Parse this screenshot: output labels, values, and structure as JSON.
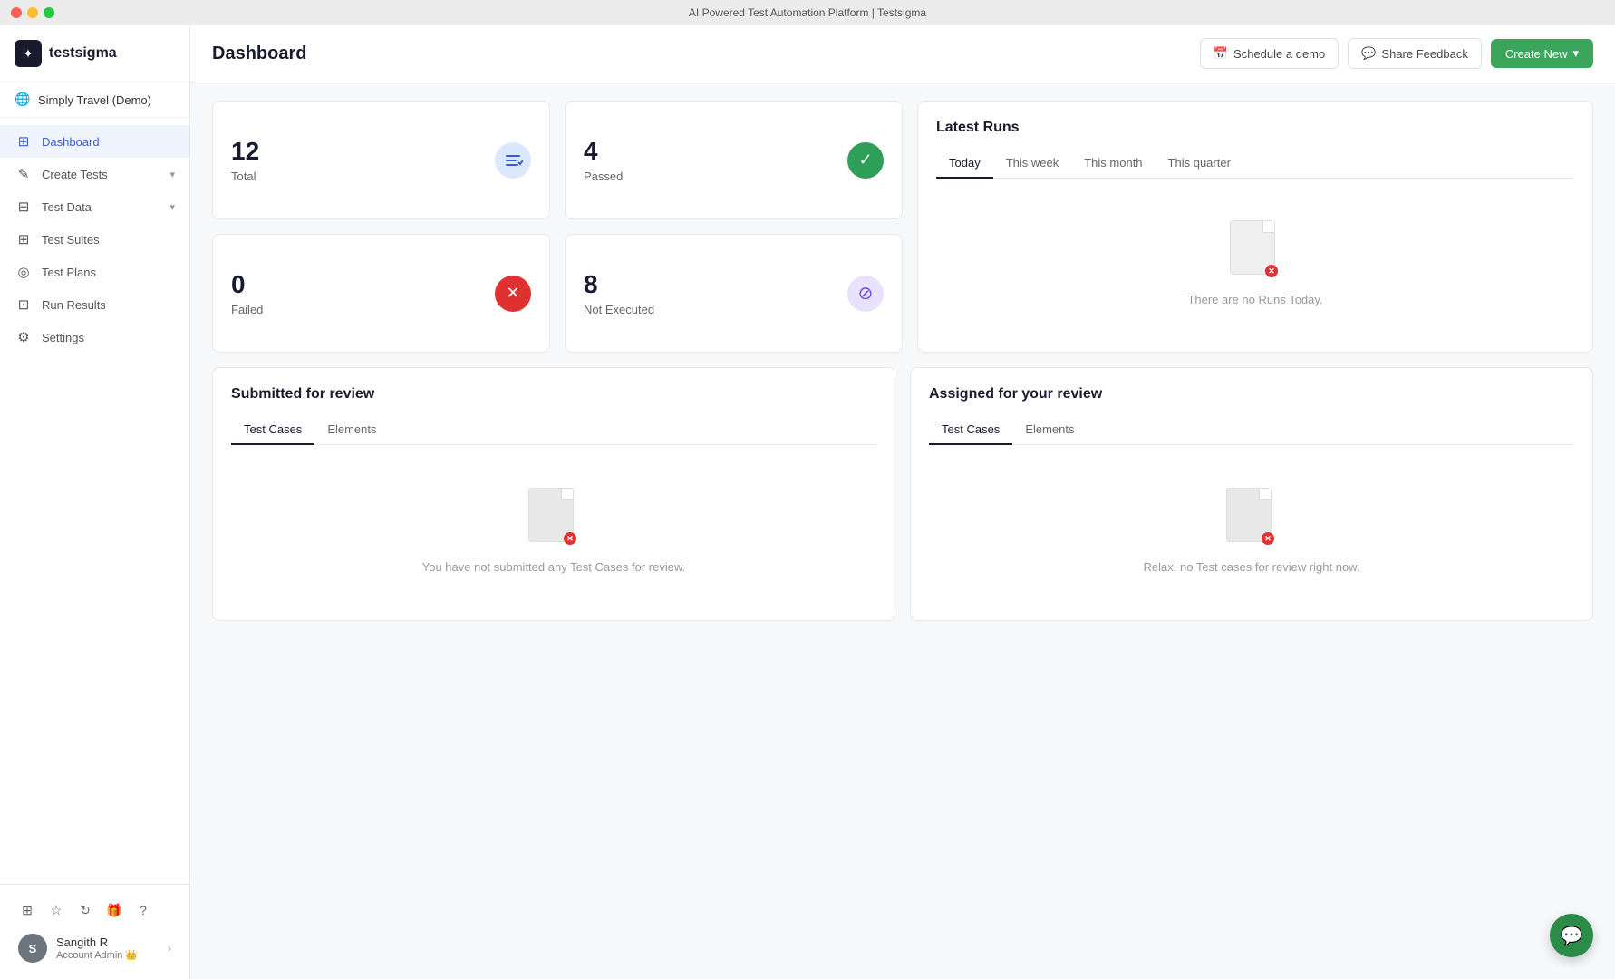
{
  "window": {
    "title": "AI Powered Test Automation Platform | Testsigma"
  },
  "sidebar": {
    "logo_text": "testsigma",
    "project_name": "Simply Travel (Demo)",
    "nav_items": [
      {
        "id": "dashboard",
        "label": "Dashboard",
        "icon": "⊞",
        "active": true
      },
      {
        "id": "create-tests",
        "label": "Create Tests",
        "icon": "✏️",
        "has_arrow": true
      },
      {
        "id": "test-data",
        "label": "Test Data",
        "icon": "⊟",
        "has_arrow": true
      },
      {
        "id": "test-suites",
        "label": "Test Suites",
        "icon": "⊞",
        "has_arrow": false
      },
      {
        "id": "test-plans",
        "label": "Test Plans",
        "icon": "◎",
        "has_arrow": false
      },
      {
        "id": "run-results",
        "label": "Run Results",
        "icon": "⊡",
        "has_arrow": false
      },
      {
        "id": "settings",
        "label": "Settings",
        "icon": "⚙",
        "has_arrow": false
      }
    ],
    "user": {
      "initials": "S",
      "name": "Sangith R",
      "role": "Account Admin 👑"
    }
  },
  "header": {
    "title": "Dashboard",
    "schedule_demo": "Schedule a demo",
    "share_feedback": "Share Feedback",
    "create_new": "Create New"
  },
  "stats": {
    "total": {
      "number": "12",
      "label": "Total"
    },
    "passed": {
      "number": "4",
      "label": "Passed"
    },
    "failed": {
      "number": "0",
      "label": "Failed"
    },
    "not_executed": {
      "number": "8",
      "label": "Not Executed"
    }
  },
  "latest_runs": {
    "title": "Latest Runs",
    "tabs": [
      "Today",
      "This week",
      "This month",
      "This quarter"
    ],
    "active_tab": "Today",
    "empty_message": "There are no Runs Today."
  },
  "submitted_review": {
    "title": "Submitted for review",
    "tabs": [
      "Test Cases",
      "Elements"
    ],
    "active_tab": "Test Cases",
    "empty_message": "You have not submitted any Test Cases for review."
  },
  "assigned_review": {
    "title": "Assigned for your review",
    "tabs": [
      "Test Cases",
      "Elements"
    ],
    "active_tab": "Test Cases",
    "empty_message": "Relax, no Test cases for review right now."
  }
}
